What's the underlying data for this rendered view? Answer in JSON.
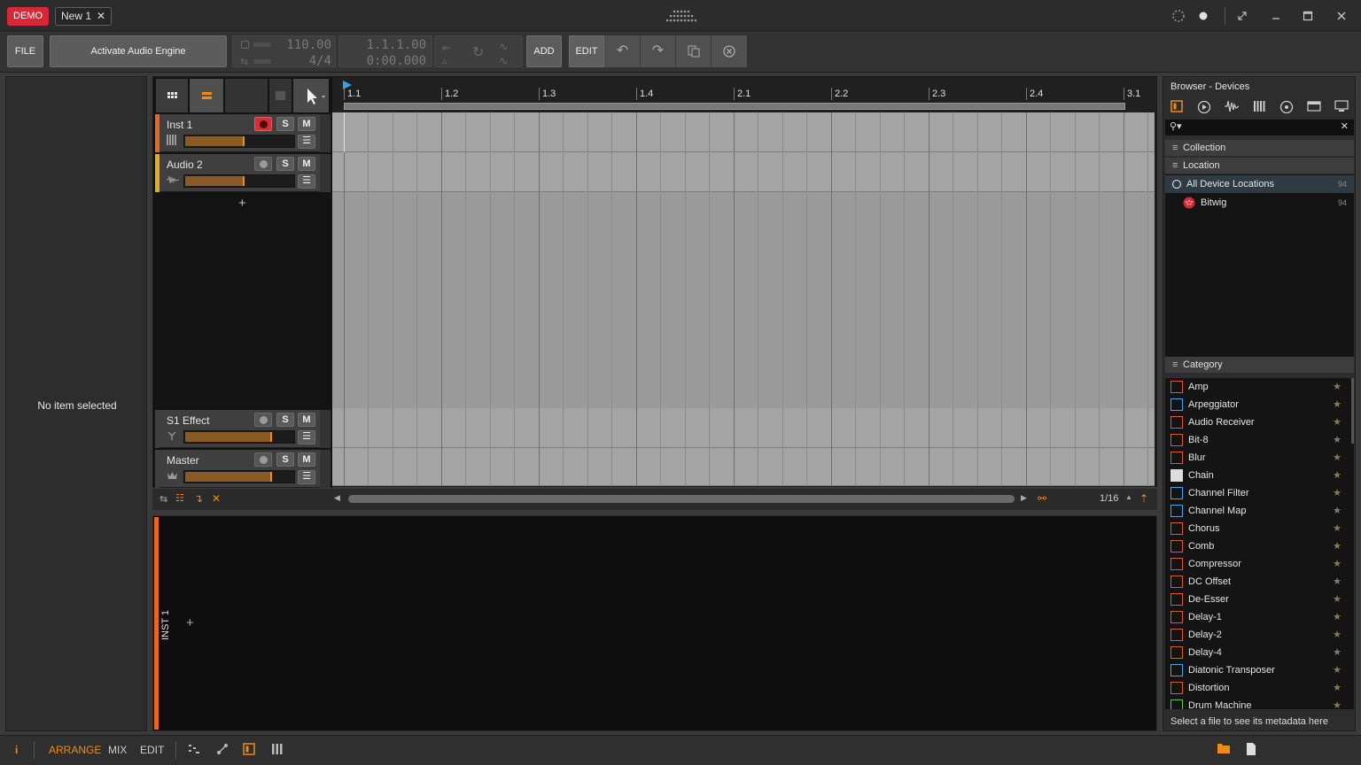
{
  "titlebar": {
    "demo_label": "DEMO",
    "project_tab": "New 1",
    "close_glyph": "✕",
    "icons": [
      "spinner-icon",
      "record-dot-icon",
      "restore-icon",
      "minimize-icon",
      "maximize-icon",
      "close-icon"
    ]
  },
  "toolbar": {
    "file_label": "FILE",
    "activate_label": "Activate Audio Engine",
    "tempo": "110.00",
    "time_signature": "4/4",
    "position_beats": "1.1.1.00",
    "position_time": "0:00.000",
    "add_label": "ADD",
    "edit_label": "EDIT"
  },
  "inspector": {
    "message": "No item selected"
  },
  "arranger": {
    "tracks": [
      {
        "name": "Inst 1",
        "color": "#e8671c",
        "armed": true,
        "volume": 0.53
      },
      {
        "name": "Audio 2",
        "color": "#e8a81c",
        "armed": false,
        "volume": 0.53
      },
      {
        "name": "S1 Effect",
        "color": "#5a5a5a",
        "armed": false,
        "volume": 0.78
      },
      {
        "name": "Master",
        "color": "#5a5a5a",
        "armed": false,
        "volume": 0.78
      }
    ],
    "solo_label": "S",
    "mute_label": "M",
    "menu_glyph": "☰",
    "add_track_glyph": "+",
    "ruler_labels": [
      "1.1",
      "1.2",
      "1.3",
      "1.4",
      "2.1",
      "2.2",
      "2.3",
      "2.4",
      "3.1"
    ],
    "grid_label": "1/16"
  },
  "detail": {
    "track_title": "INST 1",
    "add_glyph": "+"
  },
  "browser": {
    "title": "Browser - Devices",
    "collection_label": "Collection",
    "location_label": "Location",
    "locations": [
      {
        "name": "All Device Locations",
        "count": "94"
      },
      {
        "name": "Bitwig",
        "count": "94"
      }
    ],
    "category_label": "Category",
    "categories": [
      {
        "name": "Amp",
        "kind": "orange"
      },
      {
        "name": "Arpeggiator",
        "kind": "blue"
      },
      {
        "name": "Audio Receiver",
        "kind": "orange"
      },
      {
        "name": "Bit-8",
        "kind": "orange"
      },
      {
        "name": "Blur",
        "kind": "orange"
      },
      {
        "name": "Chain",
        "kind": "white"
      },
      {
        "name": "Channel Filter",
        "kind": "blue"
      },
      {
        "name": "Channel Map",
        "kind": "blue"
      },
      {
        "name": "Chorus",
        "kind": "orange"
      },
      {
        "name": "Comb",
        "kind": "orange"
      },
      {
        "name": "Compressor",
        "kind": "orange"
      },
      {
        "name": "DC Offset",
        "kind": "orange"
      },
      {
        "name": "De-Esser",
        "kind": "orange"
      },
      {
        "name": "Delay-1",
        "kind": "orange"
      },
      {
        "name": "Delay-2",
        "kind": "orange"
      },
      {
        "name": "Delay-4",
        "kind": "orange"
      },
      {
        "name": "Diatonic Transposer",
        "kind": "blue"
      },
      {
        "name": "Distortion",
        "kind": "orange"
      },
      {
        "name": "Drum Machine",
        "kind": "green"
      }
    ],
    "footer": "Select a file to see its metadata here"
  },
  "statusbar": {
    "info_glyph": "i",
    "arrange_label": "ARRANGE",
    "mix_label": "MIX",
    "edit_label": "EDIT"
  },
  "colors": {
    "accent": "#f08a1b",
    "demo": "#d7283a",
    "inst_track": "#e8671c",
    "audio_track": "#e8a81c"
  }
}
